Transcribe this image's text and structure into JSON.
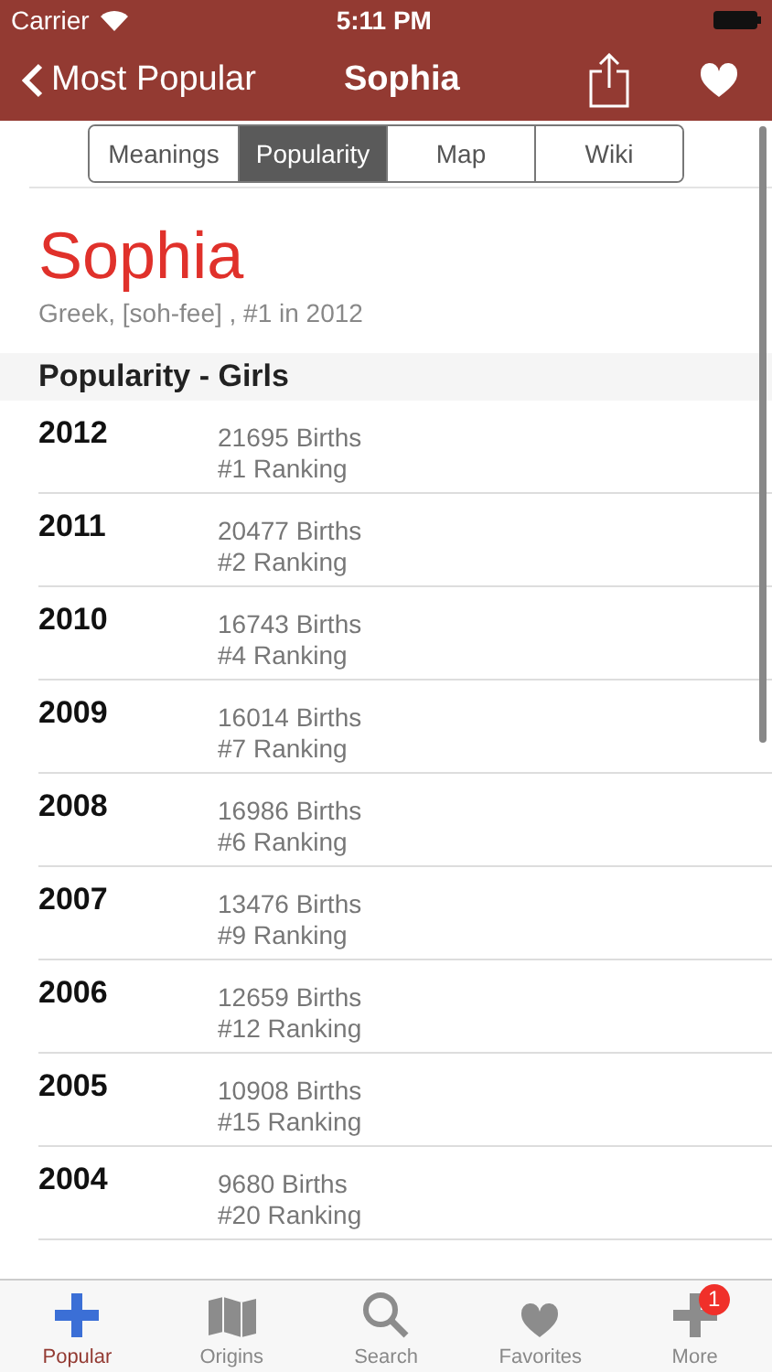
{
  "status_bar": {
    "carrier": "Carrier",
    "time": "5:11 PM"
  },
  "nav": {
    "back": "Most Popular",
    "title": "Sophia"
  },
  "segments": [
    {
      "label": "Meanings",
      "selected": false
    },
    {
      "label": "Popularity",
      "selected": true
    },
    {
      "label": "Map",
      "selected": false
    },
    {
      "label": "Wiki",
      "selected": false
    }
  ],
  "name": {
    "title": "Sophia",
    "subtitle": "Greek, [soh-fee] , #1 in 2012"
  },
  "section": "Popularity - Girls",
  "rows": [
    {
      "year": "2012",
      "births": "21695 Births",
      "ranking": "#1 Ranking"
    },
    {
      "year": "2011",
      "births": "20477 Births",
      "ranking": "#2 Ranking"
    },
    {
      "year": "2010",
      "births": "16743 Births",
      "ranking": "#4 Ranking"
    },
    {
      "year": "2009",
      "births": "16014 Births",
      "ranking": "#7 Ranking"
    },
    {
      "year": "2008",
      "births": "16986 Births",
      "ranking": "#6 Ranking"
    },
    {
      "year": "2007",
      "births": "13476 Births",
      "ranking": "#9 Ranking"
    },
    {
      "year": "2006",
      "births": "12659 Births",
      "ranking": "#12 Ranking"
    },
    {
      "year": "2005",
      "births": "10908 Births",
      "ranking": "#15 Ranking"
    },
    {
      "year": "2004",
      "births": "9680 Births",
      "ranking": "#20 Ranking"
    }
  ],
  "tabs": [
    {
      "label": "Popular",
      "kind": "plus",
      "selected": true
    },
    {
      "label": "Origins",
      "kind": "map",
      "selected": false
    },
    {
      "label": "Search",
      "kind": "search",
      "selected": false
    },
    {
      "label": "Favorites",
      "kind": "heart",
      "selected": false
    },
    {
      "label": "More",
      "kind": "plus",
      "selected": false,
      "badge": "1"
    }
  ]
}
